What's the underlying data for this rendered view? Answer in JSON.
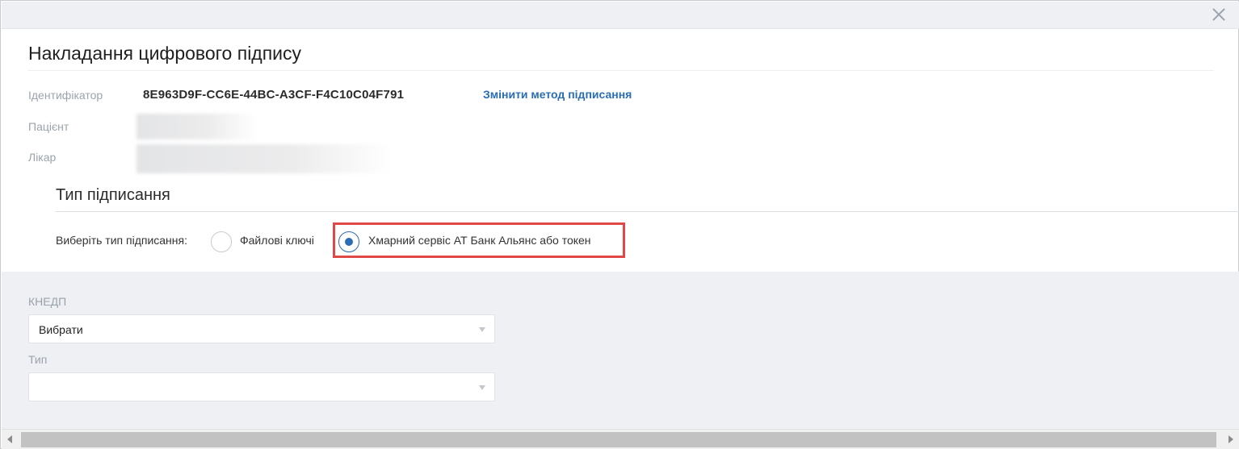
{
  "dialog": {
    "title": "Накладання цифрового підпису",
    "close_icon": "close-icon"
  },
  "info": {
    "identifier_label": "Ідентифікатор",
    "identifier_value": "8E963D9F-CC6E-44BC-A3CF-F4C10C04F791",
    "change_method_link": "Змінити метод підписання",
    "patient_label": "Пацієнт",
    "doctor_label": "Лікар"
  },
  "signing": {
    "section_title": "Тип підписання",
    "choose_label": "Виберіть тип підписання:",
    "options": [
      {
        "label": "Файлові ключі",
        "selected": false
      },
      {
        "label": "Хмарний сервіс АТ Банк Альянс або токен",
        "selected": true
      }
    ],
    "highlight_color": "#e04848"
  },
  "form": {
    "knedp_label": "КНЕДП",
    "knedp_value": "Вибрати",
    "type_label": "Тип",
    "type_value": ""
  },
  "colors": {
    "accent": "#2a6db3",
    "panel_bg": "#eef0f4"
  }
}
